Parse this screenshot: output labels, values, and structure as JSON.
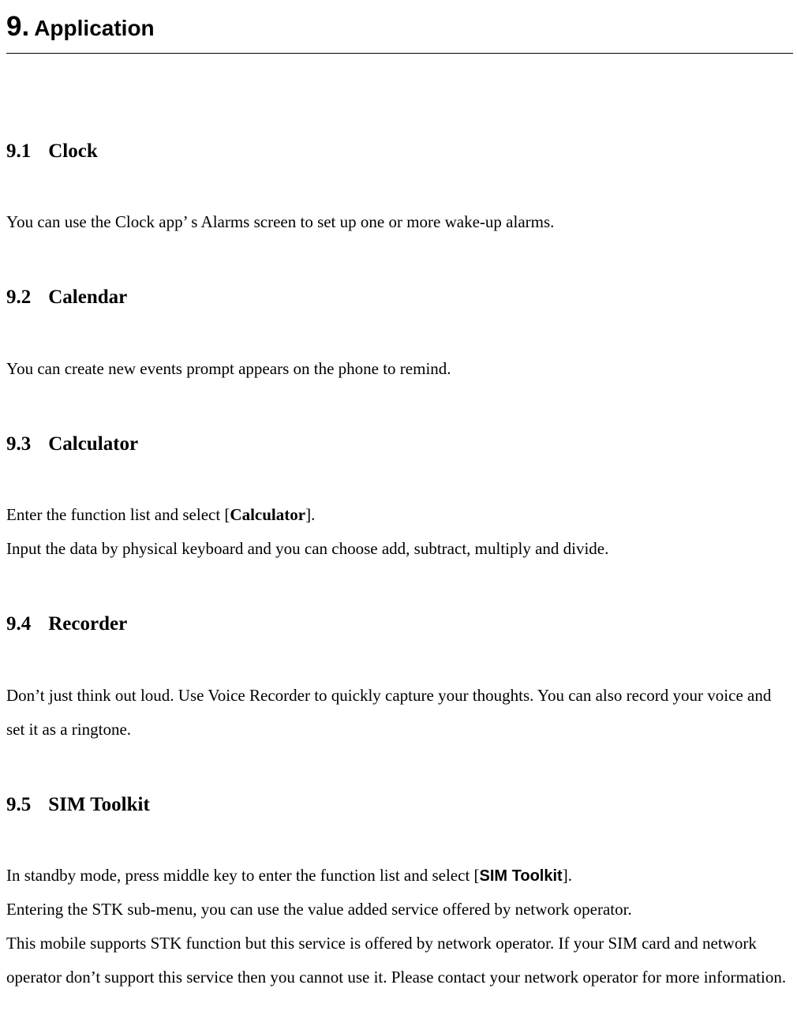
{
  "chapter": {
    "number": "9.",
    "title": "Application"
  },
  "sections": [
    {
      "num": "9.1",
      "title": "Clock",
      "body_parts": [
        {
          "text": "You can use the Clock app’   s Alarms screen to set up one or more wake-up alarms."
        }
      ]
    },
    {
      "num": "9.2",
      "title": "Calendar",
      "body_parts": [
        {
          "text": "You can create new events prompt appears on the phone to remind."
        }
      ]
    },
    {
      "num": "9.3",
      "title": "Calculator",
      "body_parts": [
        {
          "text": "Enter the function list and select ["
        },
        {
          "text": "Calculator",
          "bold": true
        },
        {
          "text": "]."
        },
        {
          "br": true
        },
        {
          "text": "Input the data by physical keyboard and you can choose add, subtract, multiply and divide."
        }
      ]
    },
    {
      "num": "9.4",
      "title": "Recorder",
      "body_parts": [
        {
          "text": "Don’t just think out loud. Use Voice Recorder to quickly capture your thoughts. You can also record your voice and set it as a ringtone."
        }
      ]
    },
    {
      "num": "9.5",
      "title": "SIM Toolkit",
      "body_parts": [
        {
          "text": "In standby mode, press middle key to enter the function list and select ["
        },
        {
          "text": "SIM Toolkit",
          "boldSans": true
        },
        {
          "text": "]."
        },
        {
          "br": true
        },
        {
          "text": "Entering the STK sub-menu, you can use the value added service offered by network operator."
        },
        {
          "br": true
        },
        {
          "text": "This mobile supports STK function but this service is offered by network operator. If your SIM card and network operator don’t support this service then you cannot use it. Please contact your network operator for more information."
        }
      ]
    }
  ]
}
